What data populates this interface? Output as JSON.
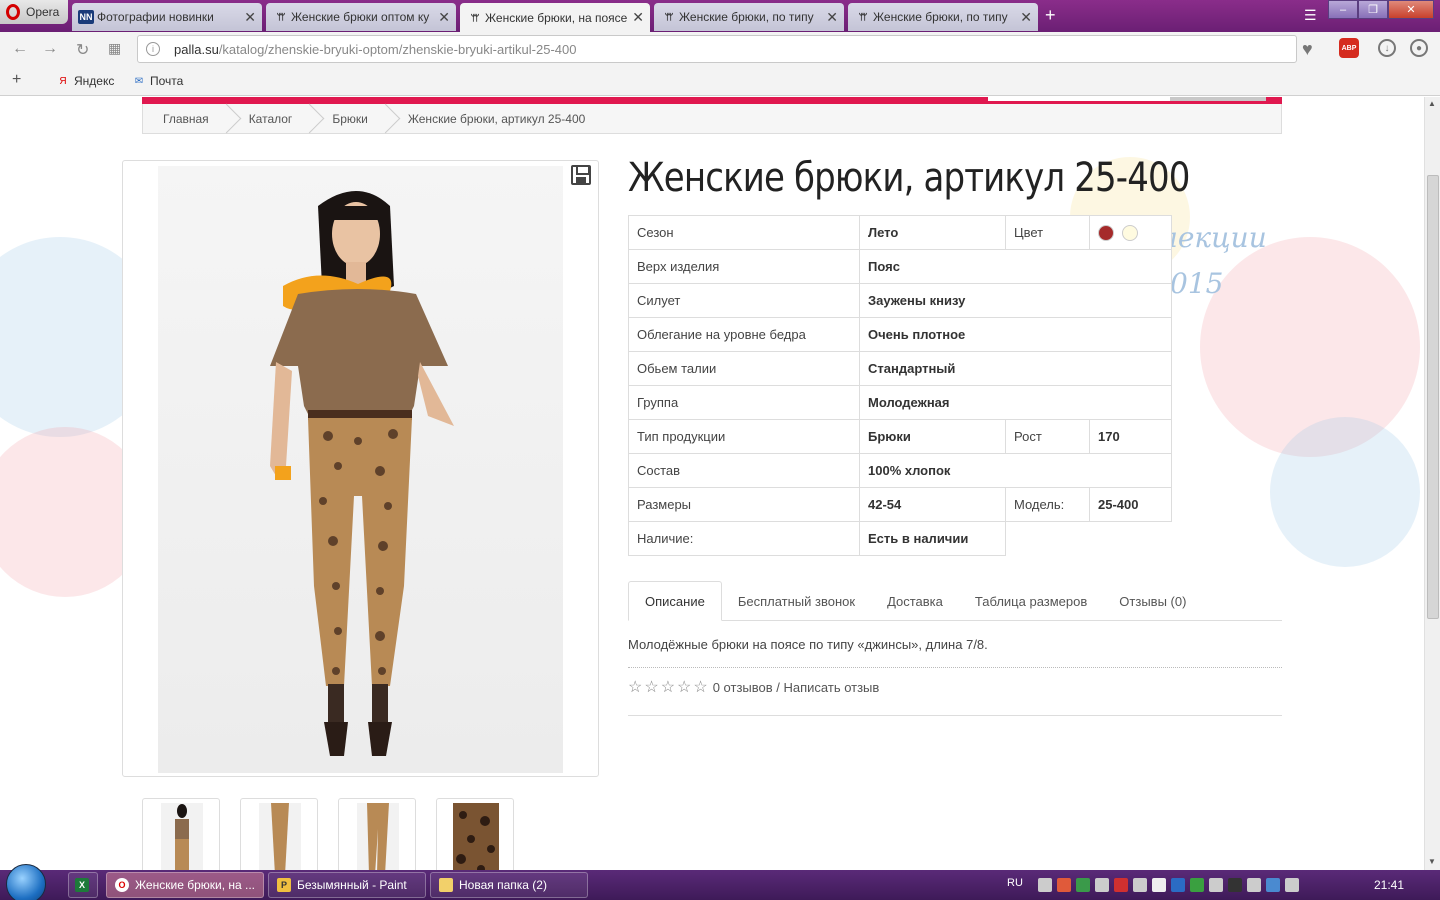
{
  "browser": {
    "app_name": "Opera",
    "tabs": [
      {
        "title": "Фотографии новинки",
        "favicon": "nn-icon"
      },
      {
        "title": "Женские брюки оптом ку",
        "favicon": "people-icon"
      },
      {
        "title": "Женские брюки, на поясе",
        "favicon": "people-icon",
        "active": true
      },
      {
        "title": "Женские брюки, по типу",
        "favicon": "people-icon"
      },
      {
        "title": "Женские брюки, по типу",
        "favicon": "people-icon"
      }
    ],
    "new_tab": "+",
    "url_host": "palla.su",
    "url_path": "/katalog/zhenskie-bryuki-optom/zhenskie-bryuki-artikul-25-400",
    "abp_label": "ABP",
    "bookmarks": [
      {
        "label": "Яндекс",
        "icon": "yandex-icon"
      },
      {
        "label": "Почта",
        "icon": "mail-icon"
      }
    ]
  },
  "breadcrumb": [
    "Главная",
    "Каталог",
    "Брюки",
    "Женские брюки, артикул 25-400"
  ],
  "promo": {
    "line1": "лекции",
    "line2": "015"
  },
  "product": {
    "title": "Женские брюки, артикул 25-400",
    "specs": {
      "season_label": "Сезон",
      "season": "Лето",
      "color_label": "Цвет",
      "colors": [
        "#a52a2a",
        "#fffbe0"
      ],
      "top_label": "Верх изделия",
      "top": "Пояс",
      "silhouette_label": "Силует",
      "silhouette": "Заужены книзу",
      "fit_label": "Облегание на уровне бедра",
      "fit": "Очень плотное",
      "waist_label": "Обьем талии",
      "waist": "Стандартный",
      "group_label": "Группа",
      "group": "Молодежная",
      "type_label": "Тип продукции",
      "type": "Брюки",
      "height_label": "Рост",
      "height": "170",
      "composition_label": "Состав",
      "composition": "100% хлопок",
      "sizes_label": "Размеры",
      "sizes": "42-54",
      "model_label": "Модель:",
      "model": "25-400",
      "availability_label": "Наличие:",
      "availability": "Есть в наличии"
    },
    "tabs": [
      "Описание",
      "Бесплатный звонок",
      "Доставка",
      "Таблица размеров",
      "Отзывы (0)"
    ],
    "description": "Молодёжные брюки на поясе по типу «джинсы», длина 7/8.",
    "reviews_text": "0 отзывов / Написать отзыв",
    "rating": 0
  },
  "taskbar": {
    "items": [
      {
        "label": "Женские брюки, на ...",
        "icon": "opera-icon",
        "active": true
      },
      {
        "label": "Безымянный - Paint",
        "icon": "paint-icon"
      },
      {
        "label": "Новая папка (2)",
        "icon": "folder-icon"
      }
    ],
    "lang": "RU",
    "time": "21:41"
  }
}
